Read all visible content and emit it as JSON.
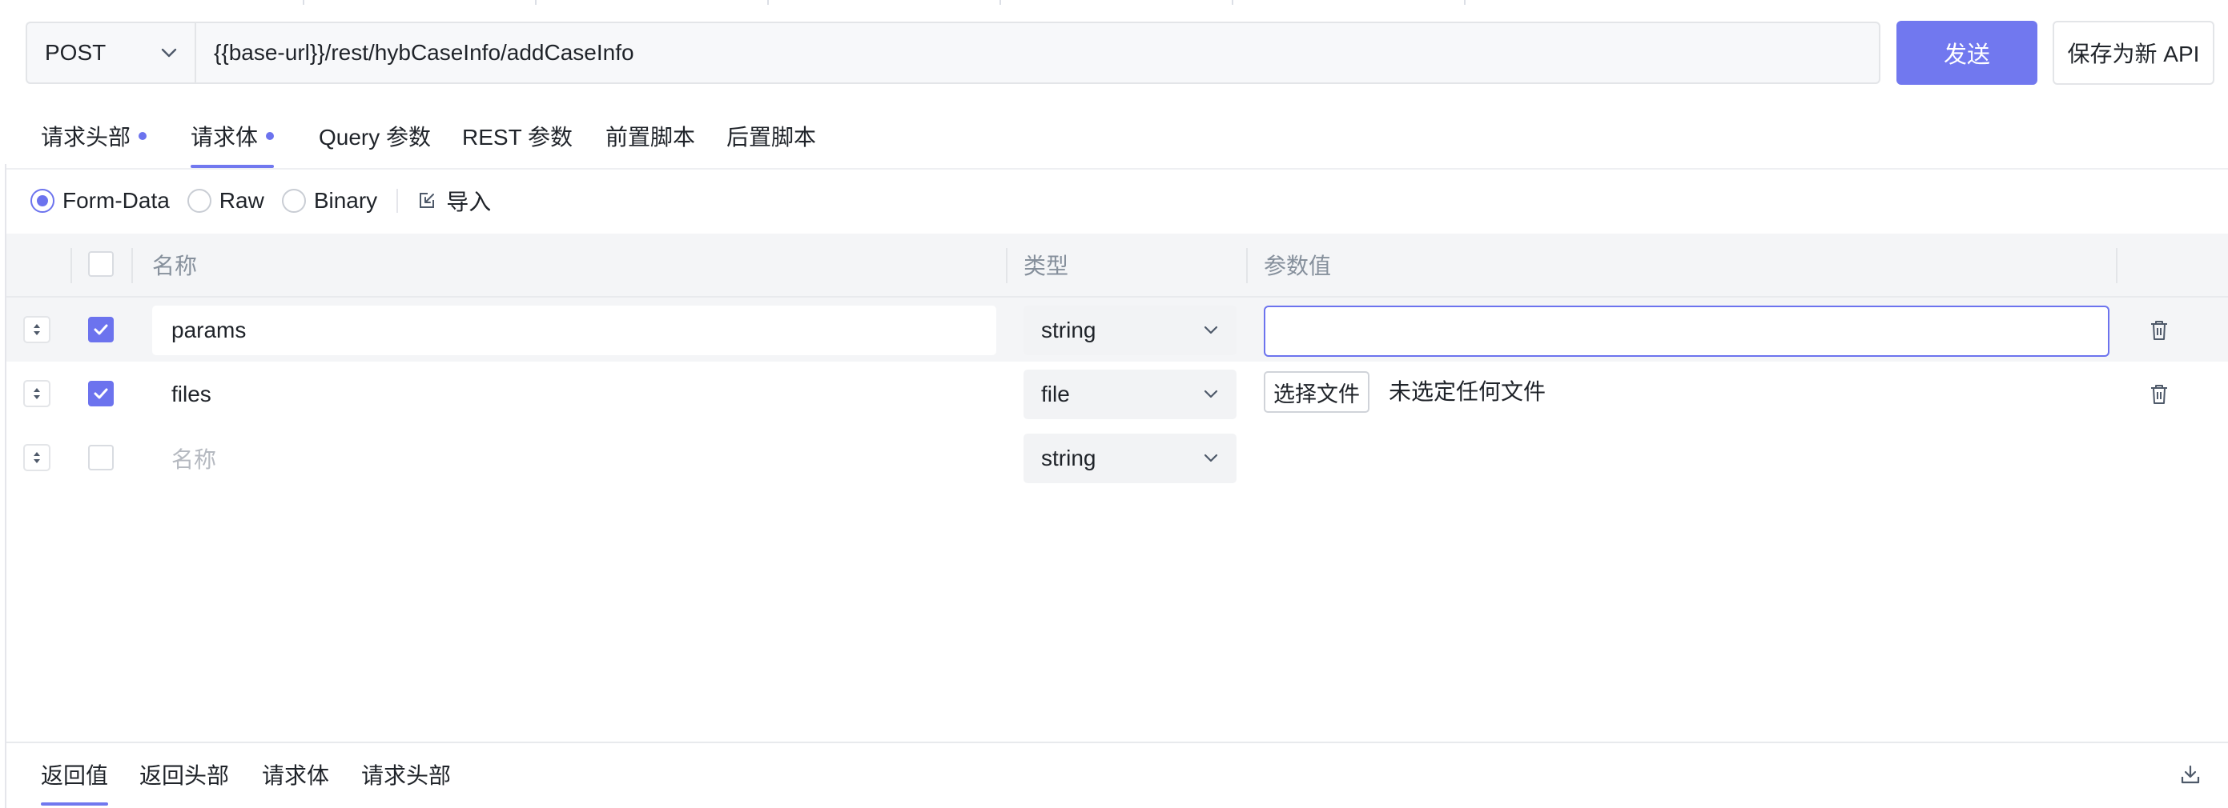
{
  "request": {
    "method": "POST",
    "url": "{{base-url}}/rest/hybCaseInfo/addCaseInfo",
    "send_label": "发送",
    "save_label": "保存为新 API"
  },
  "request_tabs": [
    {
      "label": "请求头部",
      "has_dot": true
    },
    {
      "label": "请求体",
      "has_dot": true,
      "active": true
    },
    {
      "label": "Query 参数"
    },
    {
      "label": "REST 参数"
    },
    {
      "label": "前置脚本"
    },
    {
      "label": "后置脚本"
    }
  ],
  "body_types": {
    "options": [
      "Form-Data",
      "Raw",
      "Binary"
    ],
    "selected": "Form-Data",
    "import_label": "导入"
  },
  "table": {
    "headers": {
      "name": "名称",
      "type": "类型",
      "value": "参数值"
    },
    "rows": [
      {
        "checked": true,
        "name": "params",
        "type": "string",
        "value": ""
      },
      {
        "checked": true,
        "name": "files",
        "type": "file",
        "file_button": "选择文件",
        "file_status": "未选定任何文件"
      },
      {
        "checked": false,
        "name_placeholder": "名称",
        "type": "string"
      }
    ]
  },
  "response_tabs": [
    {
      "label": "返回值",
      "active": true
    },
    {
      "label": "返回头部"
    },
    {
      "label": "请求体"
    },
    {
      "label": "请求头部"
    }
  ],
  "icons": {
    "method_dropdown": "chevron-down-icon",
    "import": "import-icon",
    "drag": "sort-handle-icon",
    "delete": "trash-icon",
    "download": "download-icon"
  },
  "colors": {
    "accent": "#7178ef",
    "header_bg": "#f4f5f7",
    "input_bg": "#f7f8fa"
  }
}
